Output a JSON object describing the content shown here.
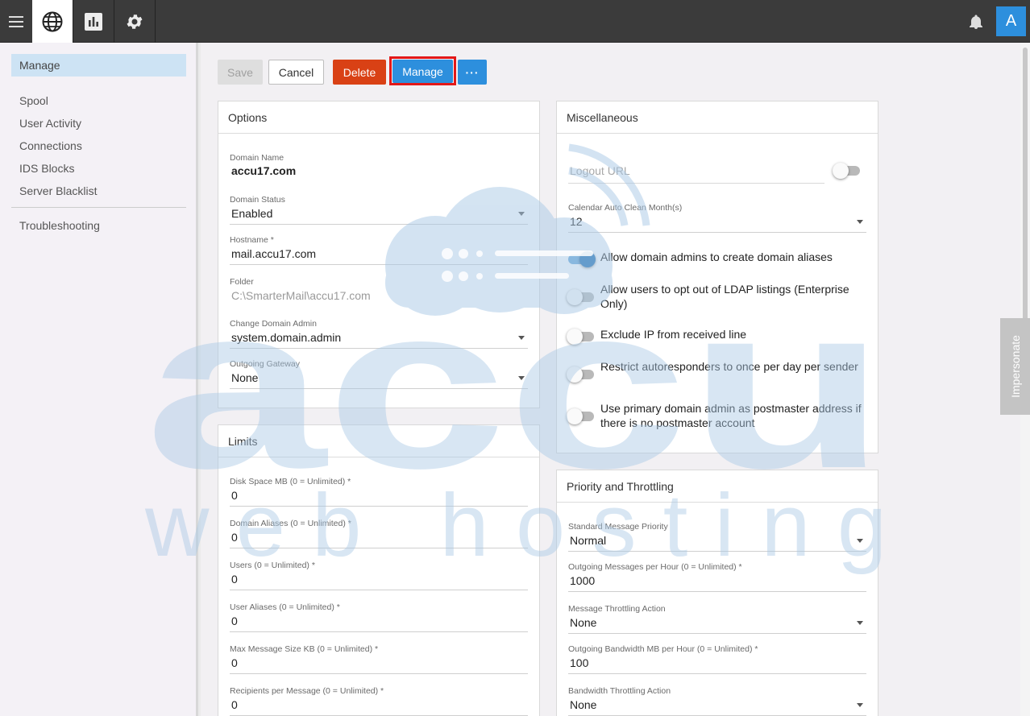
{
  "topbar": {
    "avatar_letter": "A"
  },
  "sidebar": {
    "active": "Manage",
    "items": [
      "Spool",
      "User Activity",
      "Connections",
      "IDS Blocks",
      "Server Blacklist"
    ],
    "bottom_item": "Troubleshooting"
  },
  "toolbar": {
    "save": "Save",
    "cancel": "Cancel",
    "delete": "Delete",
    "manage": "Manage",
    "more": "···"
  },
  "options": {
    "title": "Options",
    "domain_name_label": "Domain Name",
    "domain_name": "accu17.com",
    "domain_status_label": "Domain Status",
    "domain_status": "Enabled",
    "hostname_label": "Hostname *",
    "hostname": "mail.accu17.com",
    "folder_label": "Folder",
    "folder": "C:\\SmarterMail\\accu17.com",
    "change_admin_label": "Change Domain Admin",
    "change_admin": "system.domain.admin",
    "gateway_label": "Outgoing Gateway",
    "gateway": "None"
  },
  "limits": {
    "title": "Limits",
    "disk_label": "Disk Space MB (0 = Unlimited) *",
    "disk": "0",
    "aliases_label": "Domain Aliases (0 = Unlimited) *",
    "aliases": "0",
    "users_label": "Users (0 = Unlimited) *",
    "users": "0",
    "user_aliases_label": "User Aliases (0 = Unlimited) *",
    "user_aliases": "0",
    "max_size_label": "Max Message Size KB (0 = Unlimited) *",
    "max_size": "0",
    "recipients_label": "Recipients per Message (0 = Unlimited) *",
    "recipients": "0"
  },
  "misc": {
    "title": "Miscellaneous",
    "logout_url_placeholder": "Logout URL",
    "logout_url_enabled": false,
    "clean_label": "Calendar Auto Clean Month(s)",
    "clean": "12",
    "toggles": [
      {
        "label": "Allow domain admins to create domain aliases",
        "on": true
      },
      {
        "label": "Allow users to opt out of LDAP listings (Enterprise Only)",
        "on": false
      },
      {
        "label": "Exclude IP from received line",
        "on": false
      },
      {
        "label": "Restrict autoresponders to once per day per sender",
        "on": false
      },
      {
        "label": "Use primary domain admin as postmaster address if there is no postmaster account",
        "on": false
      }
    ]
  },
  "priority": {
    "title": "Priority and Throttling",
    "std_priority_label": "Standard Message Priority",
    "std_priority": "Normal",
    "out_per_hour_label": "Outgoing Messages per Hour (0 = Unlimited) *",
    "out_per_hour": "1000",
    "throttle_action_label": "Message Throttling Action",
    "throttle_action": "None",
    "bandwidth_label": "Outgoing Bandwidth MB per Hour (0 = Unlimited) *",
    "bandwidth": "100",
    "bw_action_label": "Bandwidth Throttling Action",
    "bw_action": "None"
  },
  "impersonate": "Impersonate",
  "watermark": {
    "brand": "accu",
    "tagline": "web hosting",
    "color": "#a9c9e6"
  }
}
